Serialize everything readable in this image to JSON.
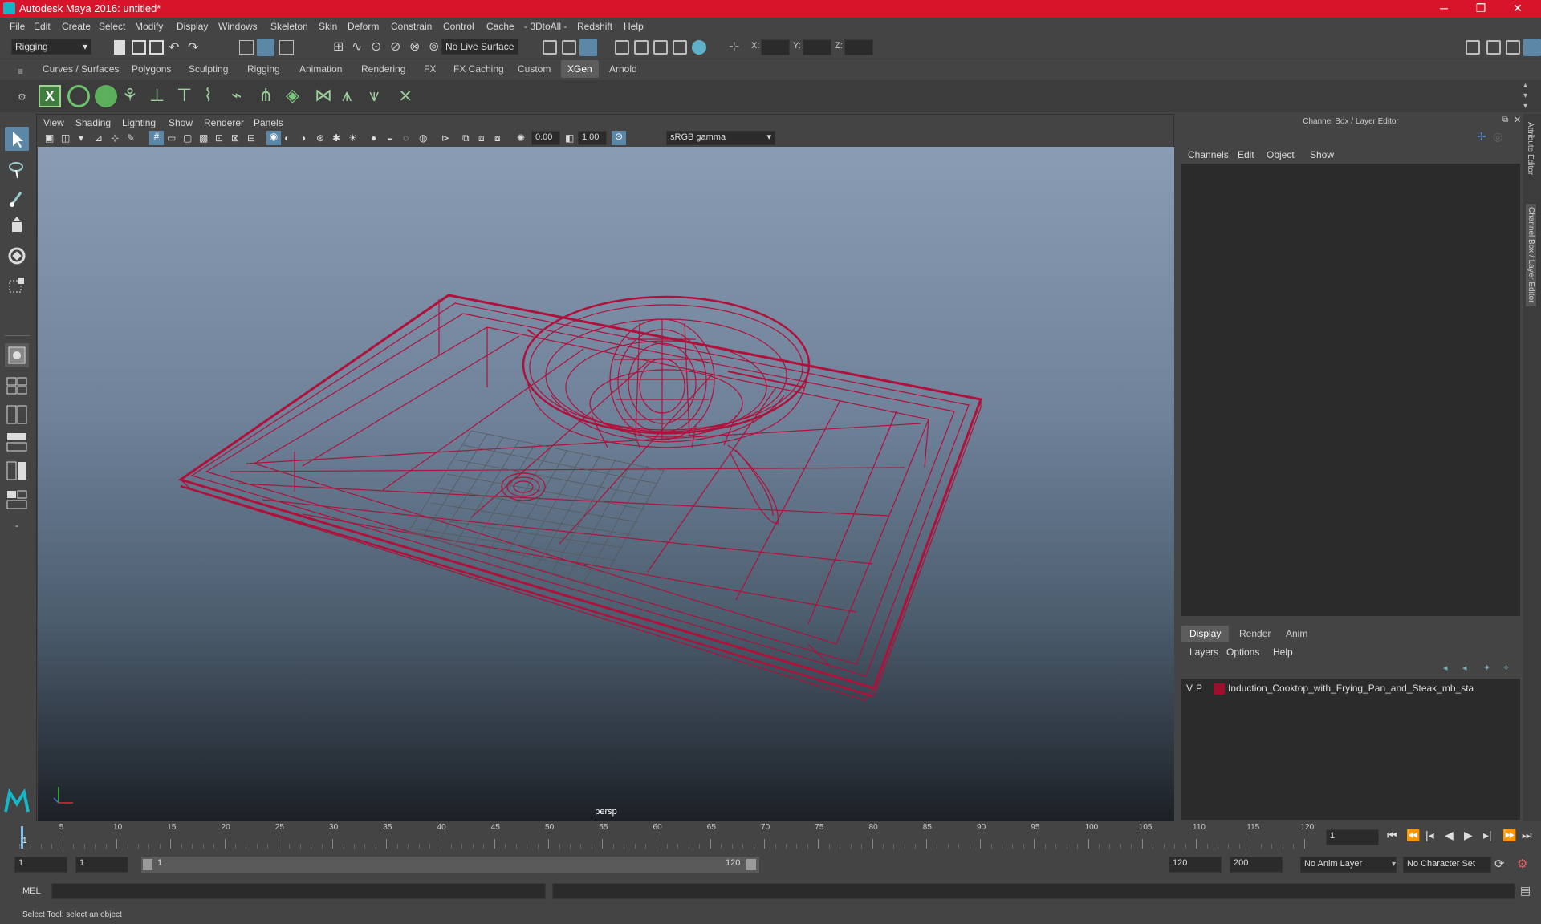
{
  "window": {
    "title": "Autodesk Maya 2016: untitled*",
    "minimize": "─",
    "restore": "❐",
    "close": "✕"
  },
  "menus": [
    "File",
    "Edit",
    "Create",
    "Select",
    "Modify",
    "Display",
    "Windows",
    "Skeleton",
    "Skin",
    "Deform",
    "Constrain",
    "Control",
    "Cache",
    "- 3DtoAll -",
    "Redshift",
    "Help"
  ],
  "statusline": {
    "menuset": "Rigging",
    "live_surface": "No Live Surface",
    "x_label": "X:",
    "y_label": "Y:",
    "z_label": "Z:"
  },
  "shelf": {
    "tabs": [
      "Curves / Surfaces",
      "Polygons",
      "Sculpting",
      "Rigging",
      "Animation",
      "Rendering",
      "FX",
      "FX Caching",
      "Custom",
      "XGen",
      "Arnold"
    ],
    "active_tab": "XGen"
  },
  "viewport": {
    "menu": [
      "View",
      "Shading",
      "Lighting",
      "Show",
      "Renderer",
      "Panels"
    ],
    "exposure": "0.00",
    "gamma": "1.00",
    "colorspace": "sRGB gamma",
    "camera": "persp"
  },
  "channelbox": {
    "title": "Channel Box / Layer Editor",
    "menu": [
      "Channels",
      "Edit",
      "Object",
      "Show"
    ],
    "side_tabs": [
      "Attribute Editor",
      "Channel Box / Layer Editor"
    ]
  },
  "layers": {
    "tabs": [
      "Display",
      "Render",
      "Anim"
    ],
    "active_tab": "Display",
    "menu": [
      "Layers",
      "Options",
      "Help"
    ],
    "items": [
      {
        "v": "V",
        "p": "P",
        "color": "#9b0f2c",
        "name": "Induction_Cooktop_with_Frying_Pan_and_Steak_mb_sta"
      }
    ]
  },
  "timeline": {
    "ticks": [
      "5",
      "10",
      "15",
      "20",
      "25",
      "30",
      "35",
      "40",
      "45",
      "50",
      "55",
      "60",
      "65",
      "70",
      "75",
      "80",
      "85",
      "90",
      "95",
      "100",
      "105",
      "110",
      "115",
      "120"
    ],
    "start_tick": "1",
    "current_frame": "1"
  },
  "range": {
    "start": "1",
    "playback_start": "1",
    "slider_start": "1",
    "slider_end": "120",
    "playback_end": "120",
    "end": "200",
    "anim_layer": "No Anim Layer",
    "character_set": "No Character Set"
  },
  "command": {
    "lang": "MEL"
  },
  "help": "Select Tool: select an object",
  "colors": {
    "titlebar": "#d7142a",
    "wireframe": "#b0103a",
    "accent": "#5d5d5d"
  }
}
